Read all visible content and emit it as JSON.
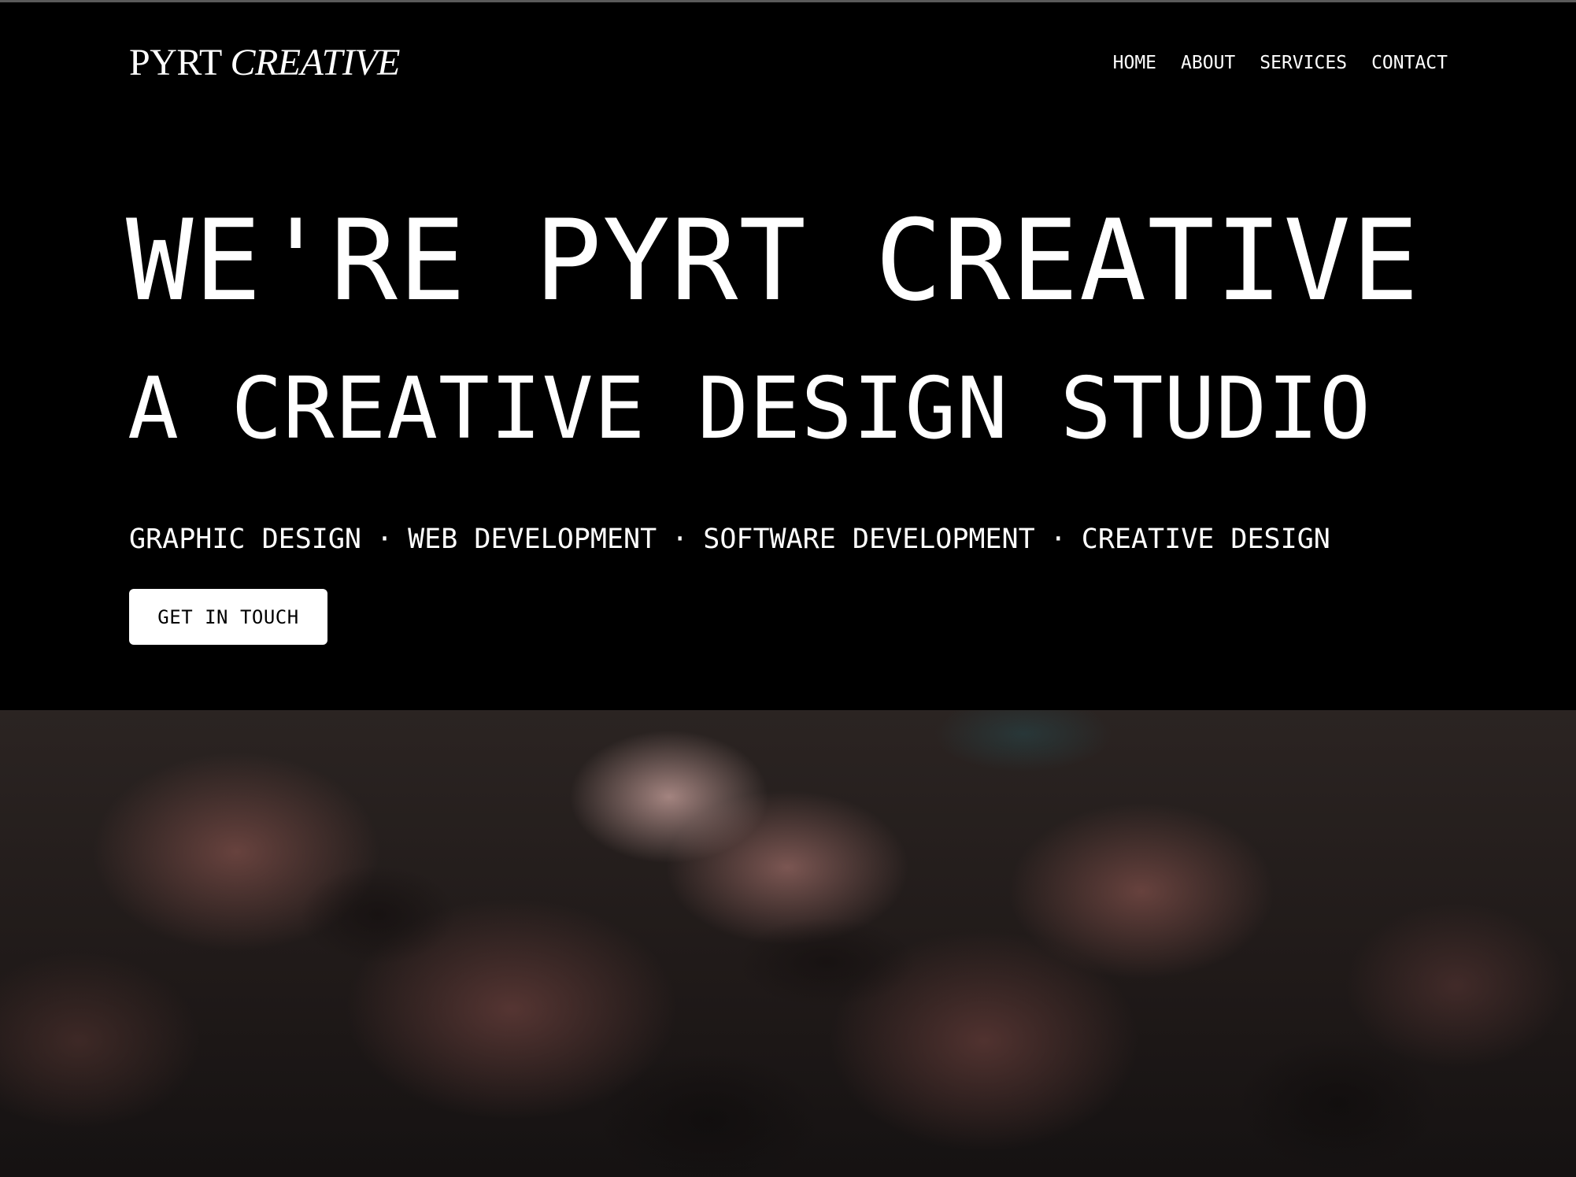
{
  "brand": {
    "name_regular": "PYRT",
    "name_italic": "CREATIVE"
  },
  "nav": {
    "items": [
      {
        "label": "HOME"
      },
      {
        "label": "ABOUT"
      },
      {
        "label": "SERVICES"
      },
      {
        "label": "CONTACT"
      }
    ]
  },
  "hero": {
    "headline": "WE'RE PYRT CREATIVE",
    "subheadline": "A CREATIVE DESIGN STUDIO",
    "services": [
      "GRAPHIC DESIGN",
      "WEB DEVELOPMENT",
      "SOFTWARE DEVELOPMENT",
      "CREATIVE DESIGN"
    ],
    "separator": "·",
    "cta_label": "GET IN TOUCH"
  },
  "colors": {
    "background": "#000000",
    "text": "#ffffff",
    "button_bg": "#ffffff",
    "button_text": "#000000"
  }
}
